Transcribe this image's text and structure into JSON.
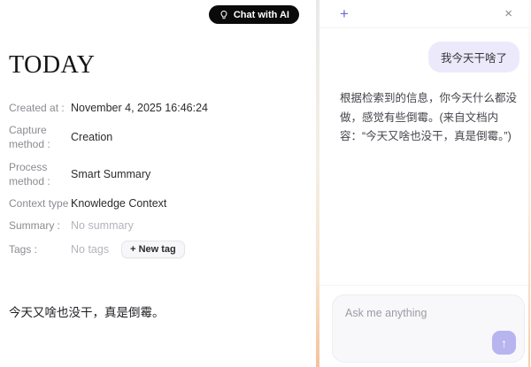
{
  "left": {
    "chat_button_label": "Chat with AI",
    "title": "TODAY",
    "metadata": [
      {
        "label": "Created at :",
        "value": "November 4, 2025 16:46:24"
      },
      {
        "label": "Capture method :",
        "value": "Creation"
      },
      {
        "label": "Process method :",
        "value": "Smart Summary"
      },
      {
        "label": "Context type :",
        "value": "Knowledge Context"
      },
      {
        "label": "Summary :",
        "value": "No summary"
      }
    ],
    "tags": {
      "label": "Tags :",
      "empty_text": "No tags",
      "new_tag_button": "+ New tag"
    },
    "note_body": "今天又啥也没干，真是倒霉。"
  },
  "chat": {
    "icons": {
      "new_chat": "+",
      "close": "×",
      "send": "↑"
    },
    "messages": [
      {
        "role": "user",
        "text": "我今天干啥了"
      },
      {
        "role": "assistant",
        "text": "根据检索到的信息，你今天什么都没做，感觉有些倒霉。(来自文档内容：“今天又啥也没干，真是倒霉。”)"
      }
    ],
    "input_placeholder": "Ask me anything"
  },
  "colors": {
    "accent_indigo": "#6c67d9",
    "user_bubble": "#eceafa",
    "send_button": "#b7b4f0",
    "chat_button": "#0a0a0a",
    "muted_text": "#b4b4bc",
    "border_peach_gradient": "#f3c39c"
  }
}
